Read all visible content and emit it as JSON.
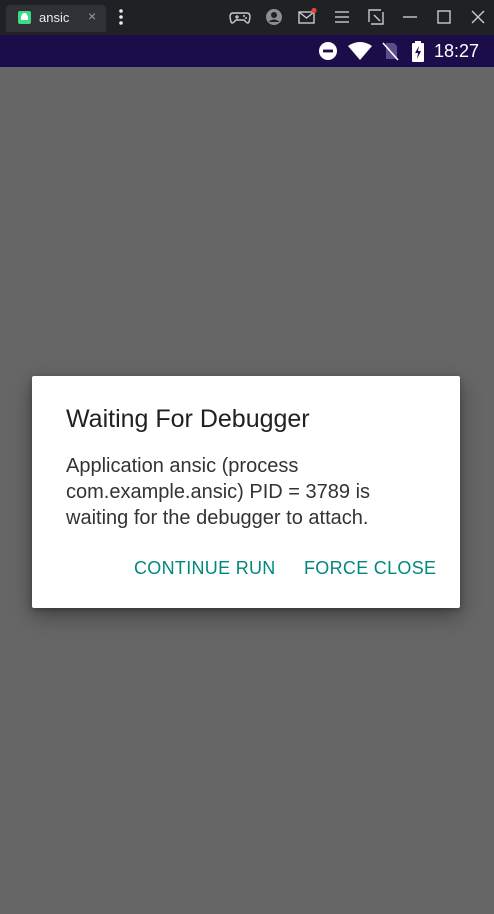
{
  "window": {
    "tab_title": "ansic",
    "tab_close": "×"
  },
  "statusbar": {
    "time": "18:27"
  },
  "dialog": {
    "title": "Waiting For Debugger",
    "message": "Application ansic (process com.example.ansic) PID = 3789 is waiting for the debugger to attach.",
    "continue_label": "CONTINUE RUN",
    "force_close_label": "FORCE CLOSE"
  },
  "colors": {
    "accent": "#00897b",
    "statusbar": "#1b0c4a",
    "scrim": "#666666"
  },
  "icons": {
    "chrome": [
      "android-app-icon",
      "more-vert-icon",
      "gamepad-icon",
      "account-icon",
      "mail-icon",
      "menu-icon",
      "screenshot-icon",
      "minimize-icon",
      "maximize-icon",
      "close-icon"
    ],
    "statusbar": [
      "do-not-disturb-icon",
      "wifi-icon",
      "no-sim-icon",
      "battery-charging-icon"
    ]
  }
}
